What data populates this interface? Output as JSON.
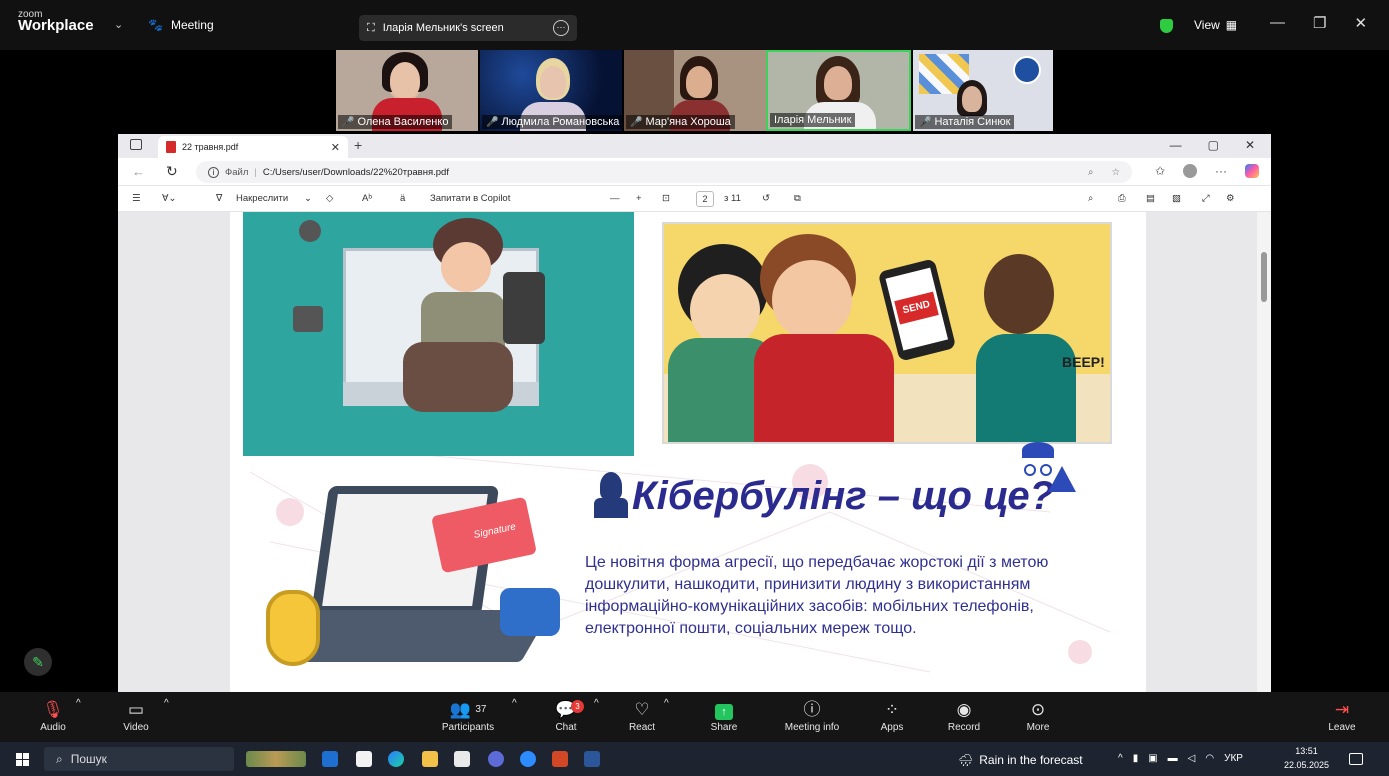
{
  "zoom": {
    "brand_small": "zoom",
    "brand_big": "Workplace",
    "meeting_label": "Meeting",
    "share_label": "Іларія Мельник's screen",
    "view_label": "View",
    "participants": [
      {
        "name": "Олена Василенко",
        "muted": true
      },
      {
        "name": "Людмила Романовська",
        "muted": true
      },
      {
        "name": "Мар'яна Хороша",
        "muted": true
      },
      {
        "name": "Іларія Мельник",
        "muted": false,
        "active": true
      },
      {
        "name": "Наталія Синюк",
        "muted": true
      }
    ],
    "bottom": {
      "audio": "Audio",
      "video": "Video",
      "participants": "Participants",
      "participants_count": "37",
      "chat": "Chat",
      "chat_badge": "3",
      "react": "React",
      "share": "Share",
      "meeting_info": "Meeting info",
      "apps": "Apps",
      "record": "Record",
      "more": "More",
      "leave": "Leave"
    }
  },
  "browser": {
    "tab_title": "22 травня.pdf",
    "address_prefix": "Файл",
    "address": "C:/Users/user/Downloads/22%20травня.pdf",
    "toolbar": {
      "draw": "Накреслити",
      "ask_copilot": "Запитати в Copilot",
      "page_current": "2",
      "page_total": "з 11"
    }
  },
  "pdf": {
    "title": "Кібербулінг – що це?",
    "body": "Це новітня форма агресії, що передбачає жорстокі дії з метою дошкулити, нашкодити, принизити людину з використанням інформаційно-комунікаційних засобів: мобільних телефонів, електронної пошти, соціальних мереж тощо.",
    "send_label": "SEND",
    "beep_label": "BEEP!",
    "signature_label": "Signature"
  },
  "taskbar": {
    "search": "Пошук",
    "weather": "Rain in the forecast",
    "lang": "УКР",
    "time": "13:51",
    "date": "22.05.2025"
  },
  "colors": {
    "accent_green": "#2ecc40",
    "title_blue": "#2a2a8f",
    "mic_red": "#ff4d4d"
  }
}
